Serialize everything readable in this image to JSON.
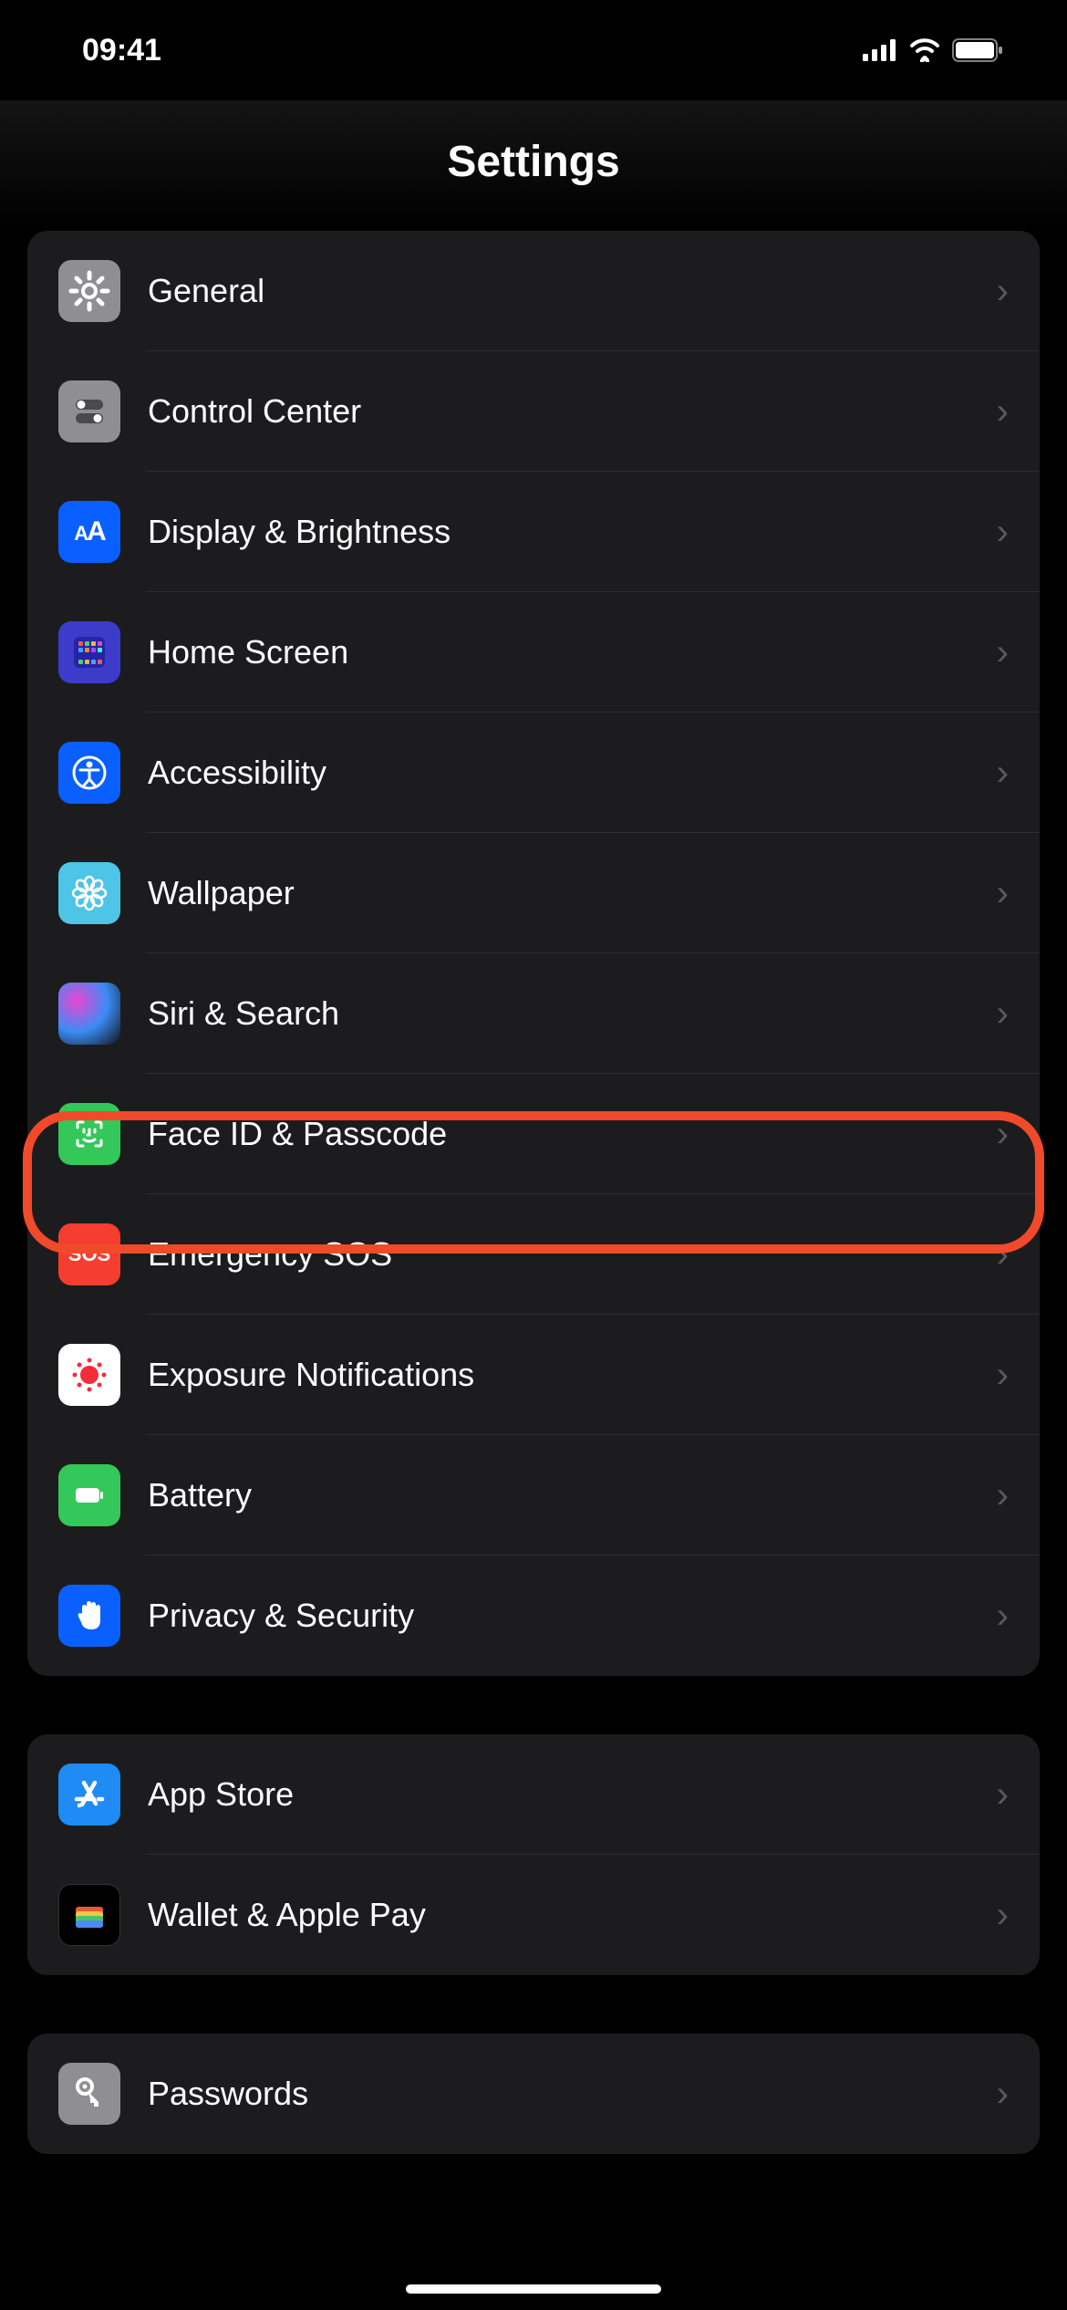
{
  "status": {
    "time": "09:41"
  },
  "header": {
    "title": "Settings"
  },
  "groups": [
    {
      "items": [
        {
          "id": "general",
          "label": "General",
          "icon": "gear-icon",
          "icon_bg": "ic-general"
        },
        {
          "id": "control-center",
          "label": "Control Center",
          "icon": "toggles-icon",
          "icon_bg": "ic-control"
        },
        {
          "id": "display",
          "label": "Display & Brightness",
          "icon": "text-size-icon",
          "icon_bg": "ic-display"
        },
        {
          "id": "home-screen",
          "label": "Home Screen",
          "icon": "apps-grid-icon",
          "icon_bg": "ic-home"
        },
        {
          "id": "accessibility",
          "label": "Accessibility",
          "icon": "accessibility-icon",
          "icon_bg": "ic-accessibility"
        },
        {
          "id": "wallpaper",
          "label": "Wallpaper",
          "icon": "flower-icon",
          "icon_bg": "ic-wallpaper"
        },
        {
          "id": "siri",
          "label": "Siri & Search",
          "icon": "siri-icon",
          "icon_bg": "ic-siri"
        },
        {
          "id": "faceid",
          "label": "Face ID & Passcode",
          "icon": "faceid-icon",
          "icon_bg": "ic-faceid",
          "highlighted": true
        },
        {
          "id": "sos",
          "label": "Emergency SOS",
          "icon": "sos-icon",
          "icon_bg": "ic-sos"
        },
        {
          "id": "exposure",
          "label": "Exposure Notifications",
          "icon": "exposure-icon",
          "icon_bg": "ic-exposure"
        },
        {
          "id": "battery",
          "label": "Battery",
          "icon": "battery-icon",
          "icon_bg": "ic-battery"
        },
        {
          "id": "privacy",
          "label": "Privacy & Security",
          "icon": "hand-icon",
          "icon_bg": "ic-privacy"
        }
      ]
    },
    {
      "items": [
        {
          "id": "appstore",
          "label": "App Store",
          "icon": "appstore-icon",
          "icon_bg": "ic-appstore"
        },
        {
          "id": "wallet",
          "label": "Wallet & Apple Pay",
          "icon": "wallet-icon",
          "icon_bg": "ic-wallet"
        }
      ]
    },
    {
      "items": [
        {
          "id": "passwords",
          "label": "Passwords",
          "icon": "key-icon",
          "icon_bg": "ic-passwords"
        }
      ]
    }
  ],
  "icon_text": {
    "sos": "SOS",
    "display": "AA"
  }
}
